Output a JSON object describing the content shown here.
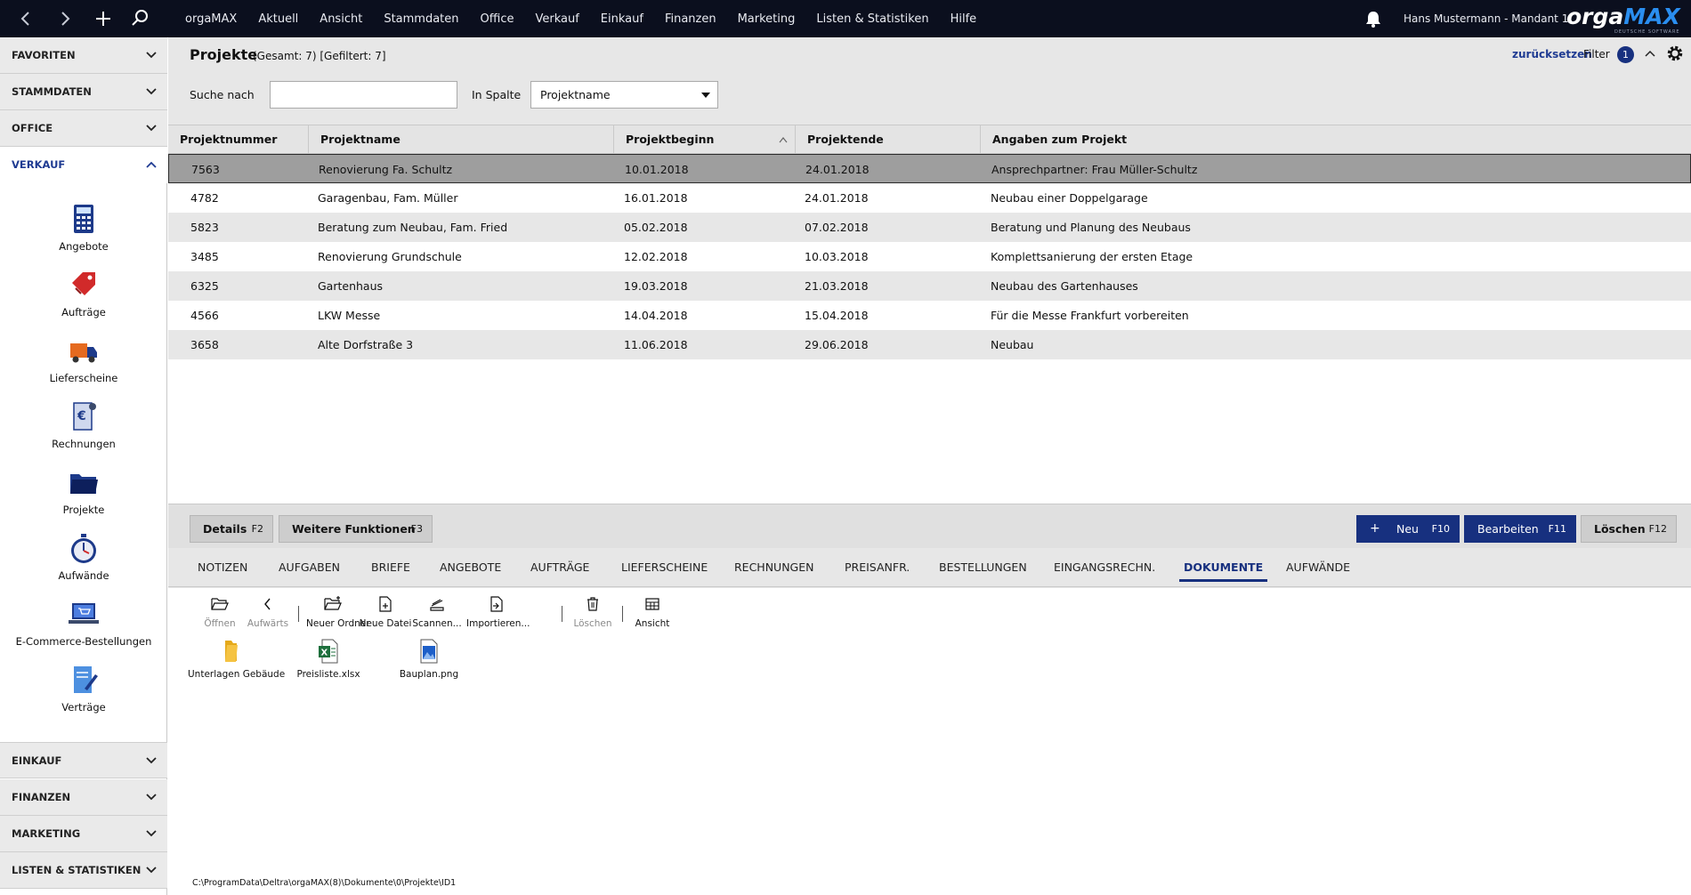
{
  "topbar": {
    "menu": [
      "orgaMAX",
      "Aktuell",
      "Ansicht",
      "Stammdaten",
      "Office",
      "Verkauf",
      "Einkauf",
      "Finanzen",
      "Marketing",
      "Listen & Statistiken",
      "Hilfe"
    ],
    "user": "Hans Mustermann - Mandant 1",
    "logo_part1": "orga",
    "logo_part2": "MAX",
    "logo_sub": "DEUTSCHE SOFTWARE",
    "quick_icons": [
      "back-icon",
      "forward-icon",
      "plus-icon",
      "search-icon"
    ],
    "bell_icon": "bell-icon"
  },
  "sidebar": {
    "sections_top": [
      {
        "label": "FAVORITEN"
      },
      {
        "label": "STAMMDATEN"
      },
      {
        "label": "OFFICE"
      }
    ],
    "open_section": {
      "label": "VERKAUF"
    },
    "items": [
      {
        "label": "Angebote",
        "icon": "calculator-icon"
      },
      {
        "label": "Aufträge",
        "icon": "tag-icon"
      },
      {
        "label": "Lieferscheine",
        "icon": "truck-icon"
      },
      {
        "label": "Rechnungen",
        "icon": "invoice-euro-icon"
      },
      {
        "label": "Projekte",
        "icon": "folder-icon"
      },
      {
        "label": "Aufwände",
        "icon": "stopwatch-icon"
      },
      {
        "label": "E-Commerce-Bestellungen",
        "icon": "laptop-cart-icon"
      },
      {
        "label": "Verträge",
        "icon": "contract-pen-icon"
      }
    ],
    "sections_bottom": [
      {
        "label": "EINKAUF"
      },
      {
        "label": "FINANZEN"
      },
      {
        "label": "MARKETING"
      },
      {
        "label": "LISTEN & STATISTIKEN"
      }
    ]
  },
  "header": {
    "title": "Projekte",
    "count": "(Gesamt: 7) [Gefiltert: 7]",
    "reset": "zurücksetzen",
    "filter": "Filter",
    "filter_count": "1"
  },
  "search": {
    "label": "Suche nach",
    "value": "",
    "column_label": "In Spalte",
    "column_value": "Projektname"
  },
  "table": {
    "columns": [
      "Projektnummer",
      "Projektname",
      "Projektbeginn",
      "Projektende",
      "Angaben zum Projekt"
    ],
    "rows": [
      [
        "7563",
        "Renovierung Fa. Schultz",
        "10.01.2018",
        "24.01.2018",
        "Ansprechpartner: Frau Müller-Schultz"
      ],
      [
        "4782",
        "Garagenbau, Fam. Müller",
        "16.01.2018",
        "24.01.2018",
        "Neubau einer Doppelgarage"
      ],
      [
        "5823",
        "Beratung zum Neubau, Fam. Fried",
        "05.02.2018",
        "07.02.2018",
        "Beratung und Planung des Neubaus"
      ],
      [
        "3485",
        "Renovierung Grundschule",
        "12.02.2018",
        "10.03.2018",
        "Komplettsanierung der ersten Etage"
      ],
      [
        "6325",
        "Gartenhaus",
        "19.03.2018",
        "21.03.2018",
        "Neubau des Gartenhauses"
      ],
      [
        "4566",
        "LKW Messe",
        "14.04.2018",
        "15.04.2018",
        "Für die Messe Frankfurt vorbereiten"
      ],
      [
        "3658",
        "Alte Dorfstraße 3",
        "11.06.2018",
        "29.06.2018",
        "Neubau"
      ]
    ],
    "selected_row": 0
  },
  "actions": {
    "details": {
      "label": "Details",
      "key": "F2"
    },
    "more": {
      "label": "Weitere Funktionen",
      "key": "F3"
    },
    "new": {
      "plus": "+",
      "label": "Neu",
      "key": "F10"
    },
    "edit": {
      "label": "Bearbeiten",
      "key": "F11"
    },
    "delete": {
      "label": "Löschen",
      "key": "F12"
    }
  },
  "tabs": [
    "NOTIZEN",
    "AUFGABEN",
    "BRIEFE",
    "ANGEBOTE",
    "AUFTRÄGE",
    "LIEFERSCHEINE",
    "RECHNUNGEN",
    "PREISANFR.",
    "BESTELLUNGEN",
    "EINGANGSRECHN.",
    "DOKUMENTE",
    "AUFWÄNDE"
  ],
  "active_tab": "DOKUMENTE",
  "doc_toolbar": [
    {
      "label": "Öffnen",
      "icon": "open-folder-icon",
      "enabled": false
    },
    {
      "label": "Aufwärts",
      "icon": "chevron-left-icon",
      "enabled": false
    },
    {
      "label": "Neuer Ordner",
      "icon": "new-folder-icon",
      "enabled": true
    },
    {
      "label": "Neue Datei",
      "icon": "new-file-icon",
      "enabled": true
    },
    {
      "label": "Scannen...",
      "icon": "scanner-icon",
      "enabled": true
    },
    {
      "label": "Importieren...",
      "icon": "import-icon",
      "enabled": true
    },
    {
      "label": "Löschen",
      "icon": "trash-icon",
      "enabled": false
    },
    {
      "label": "Ansicht",
      "icon": "view-grid-icon",
      "enabled": true
    }
  ],
  "files": [
    {
      "name": "Unterlagen Gebäude",
      "icon": "folder-icon"
    },
    {
      "name": "Preisliste.xlsx",
      "icon": "excel-file-icon"
    },
    {
      "name": "Bauplan.png",
      "icon": "image-file-icon"
    }
  ],
  "path": "C:\\ProgramData\\Deltra\\orgaMAX(8)\\Dokumente\\0\\Projekte\\ID1",
  "colors": {
    "topbar": "#0b0f1e",
    "accent": "#17307f",
    "selected_row": "#9e9e9e"
  }
}
